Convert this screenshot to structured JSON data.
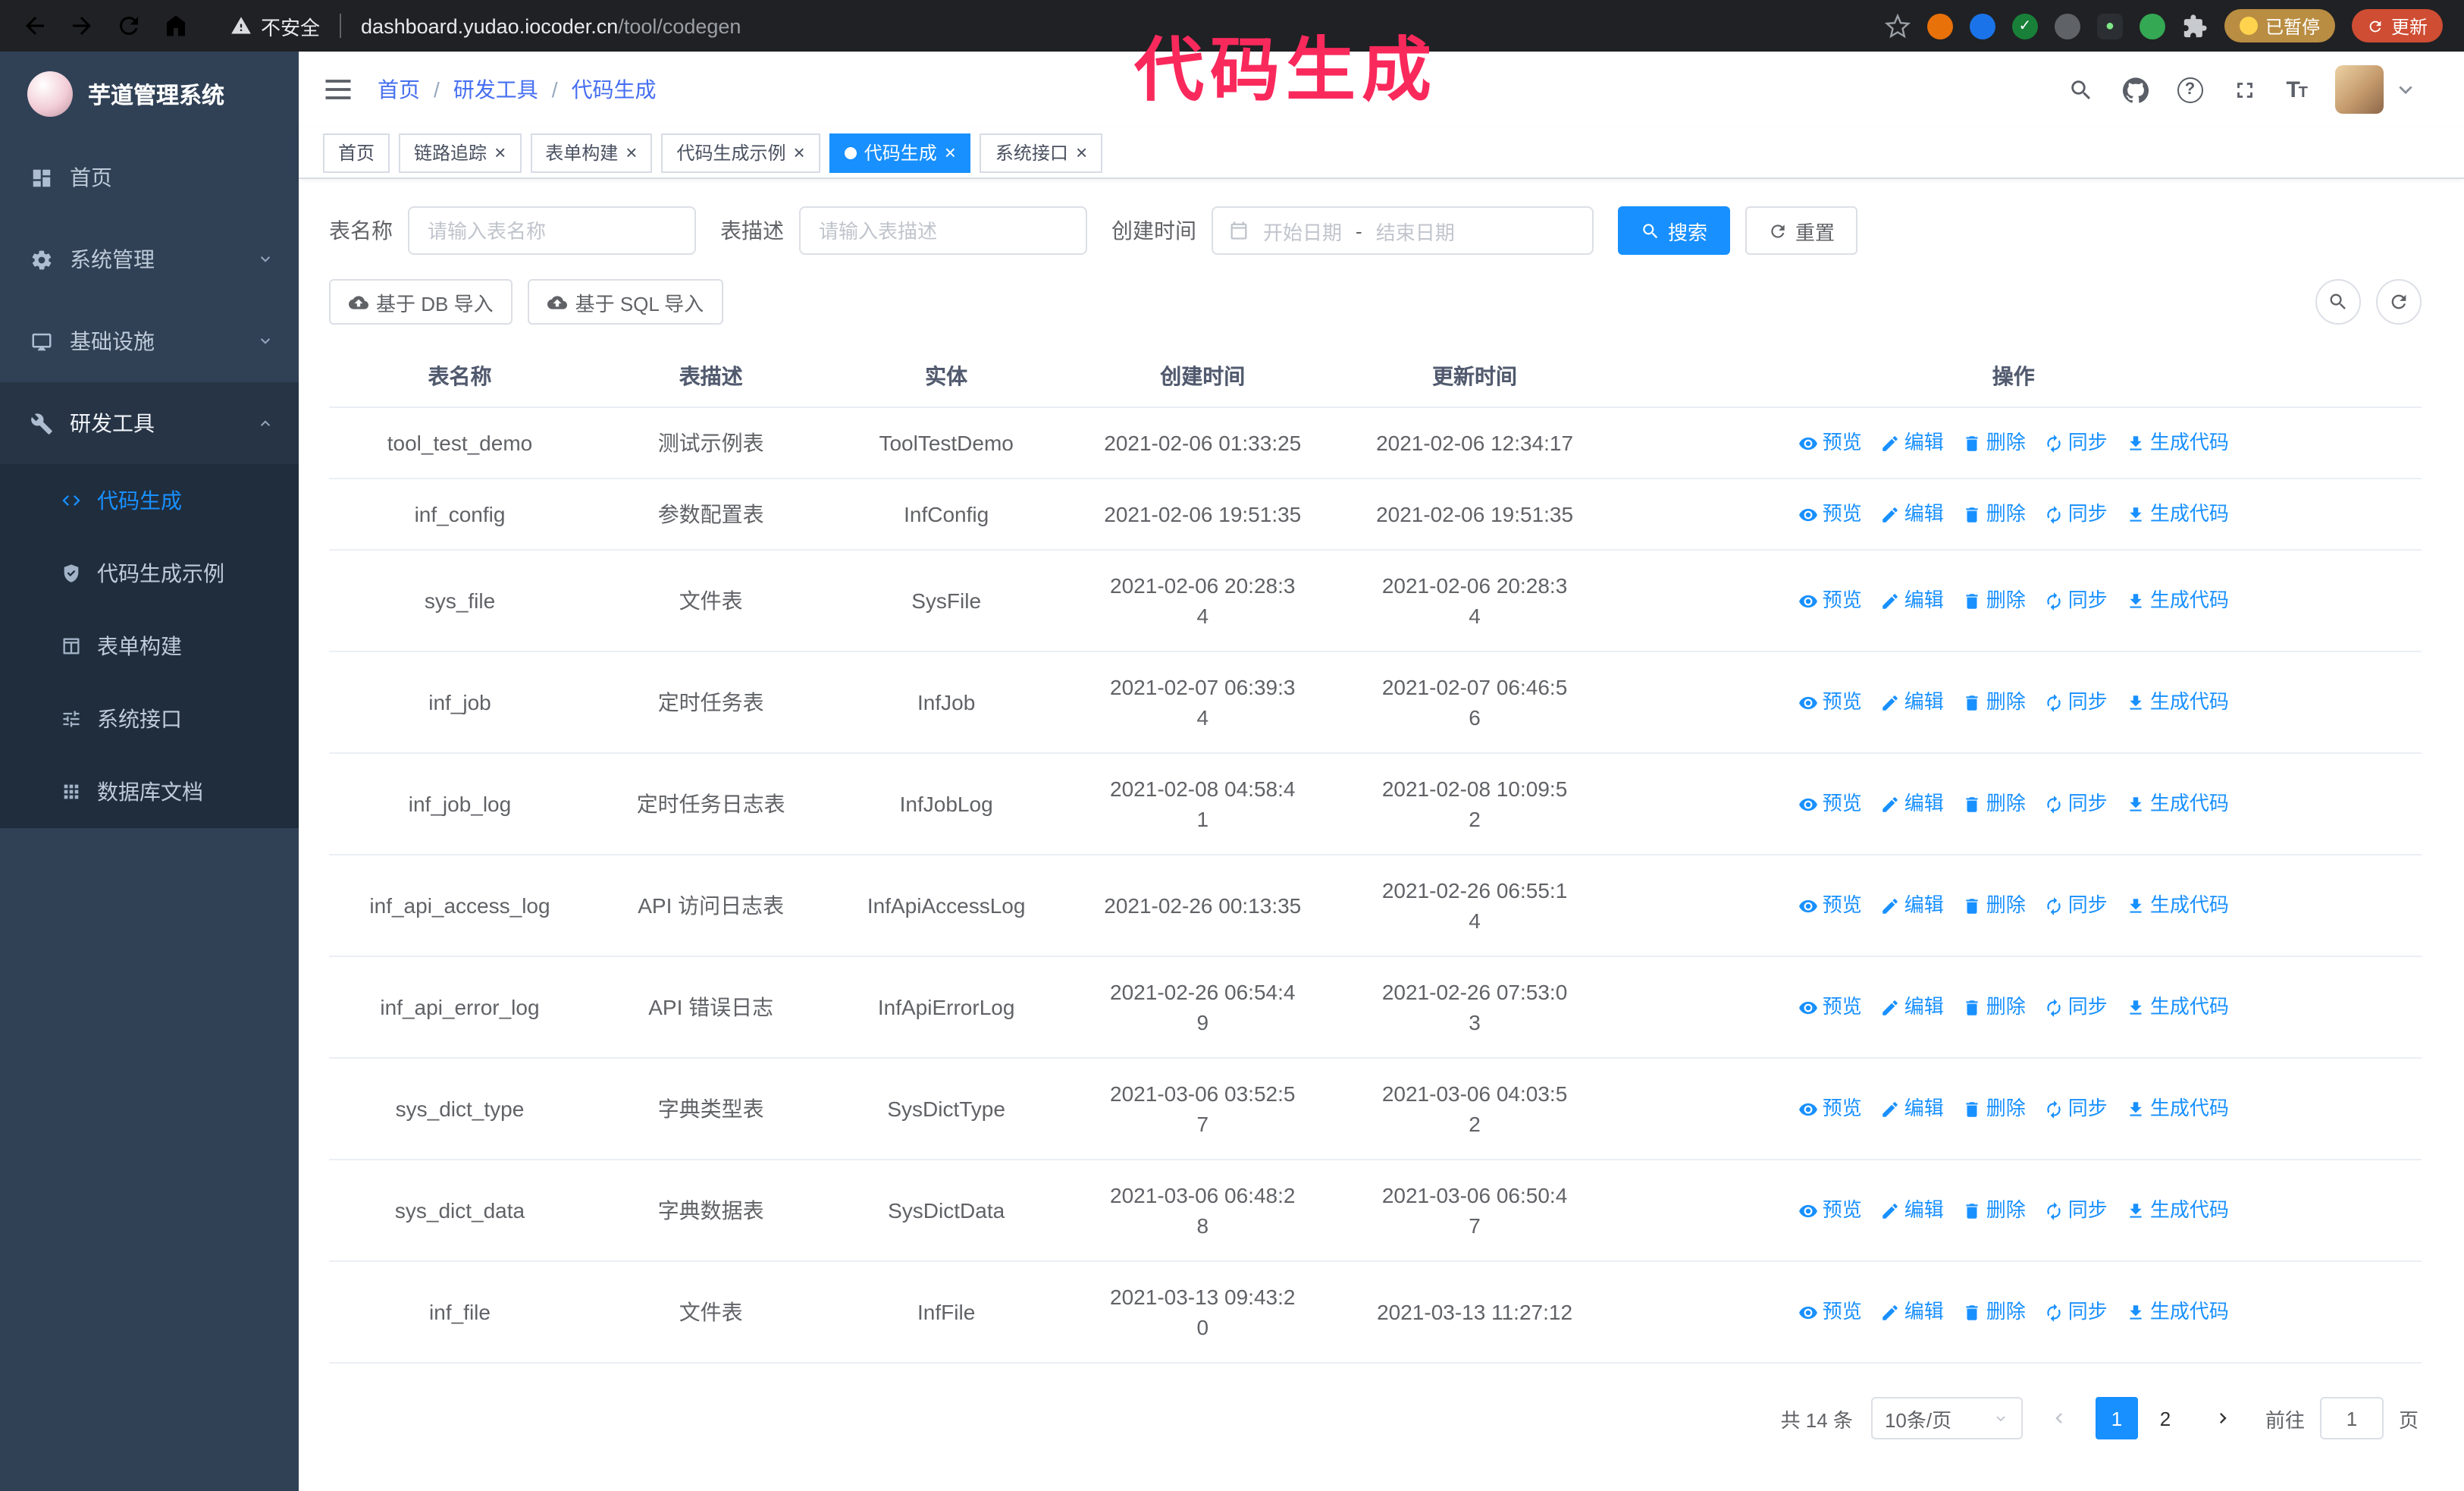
{
  "colors": {
    "accent": "#1890ff",
    "annotation": "#fa295c",
    "sidebar_bg": "#304156",
    "submenu_bg": "#1f2d3d"
  },
  "annotation": "代码生成",
  "browser": {
    "security_warning": "不安全",
    "url_host": "dashboard.yudao.iocoder.cn",
    "url_path": "/tool/codegen",
    "paused_badge": "已暂停",
    "update_button": "更新"
  },
  "sidebar": {
    "app_title": "芋道管理系统",
    "menu": [
      {
        "label": "首页",
        "icon": "dashboard",
        "type": "item"
      },
      {
        "label": "系统管理",
        "icon": "gear",
        "type": "group",
        "state": "collapsed"
      },
      {
        "label": "基础设施",
        "icon": "monitor",
        "type": "group",
        "state": "collapsed"
      },
      {
        "label": "研发工具",
        "icon": "wrench",
        "type": "group",
        "state": "expanded",
        "active": true
      }
    ],
    "submenu": [
      {
        "label": "代码生成",
        "icon": "code",
        "active": true
      },
      {
        "label": "代码生成示例",
        "icon": "shield"
      },
      {
        "label": "表单构建",
        "icon": "form"
      },
      {
        "label": "系统接口",
        "icon": "api"
      },
      {
        "label": "数据库文档",
        "icon": "grid"
      }
    ]
  },
  "navbar": {
    "breadcrumb": [
      "首页",
      "研发工具",
      "代码生成"
    ]
  },
  "tabs": [
    {
      "label": "首页",
      "closable": false,
      "active": false
    },
    {
      "label": "链路追踪",
      "closable": true,
      "active": false
    },
    {
      "label": "表单构建",
      "closable": true,
      "active": false
    },
    {
      "label": "代码生成示例",
      "closable": true,
      "active": false
    },
    {
      "label": "代码生成",
      "closable": true,
      "active": true
    },
    {
      "label": "系统接口",
      "closable": true,
      "active": false
    }
  ],
  "filters": {
    "table_name_label": "表名称",
    "table_name_placeholder": "请输入表名称",
    "table_desc_label": "表描述",
    "table_desc_placeholder": "请输入表描述",
    "create_time_label": "创建时间",
    "date_start_placeholder": "开始日期",
    "date_separator": "-",
    "date_end_placeholder": "结束日期",
    "search_button": "搜索",
    "reset_button": "重置"
  },
  "toolbar": {
    "import_db_button": "基于 DB 导入",
    "import_sql_button": "基于 SQL 导入"
  },
  "table": {
    "columns": [
      "表名称",
      "表描述",
      "实体",
      "创建时间",
      "更新时间",
      "操作"
    ],
    "op_labels": [
      "预览",
      "编辑",
      "删除",
      "同步",
      "生成代码"
    ],
    "rows": [
      {
        "name": "tool_test_demo",
        "desc": "测试示例表",
        "entity": "ToolTestDemo",
        "created": "2021-02-06 01:33:25",
        "updated": "2021-02-06 12:34:17"
      },
      {
        "name": "inf_config",
        "desc": "参数配置表",
        "entity": "InfConfig",
        "created": "2021-02-06 19:51:35",
        "updated": "2021-02-06 19:51:35"
      },
      {
        "name": "sys_file",
        "desc": "文件表",
        "entity": "SysFile",
        "created": "2021-02-06 20:28:3\n4",
        "updated": "2021-02-06 20:28:3\n4"
      },
      {
        "name": "inf_job",
        "desc": "定时任务表",
        "entity": "InfJob",
        "created": "2021-02-07 06:39:3\n4",
        "updated": "2021-02-07 06:46:5\n6"
      },
      {
        "name": "inf_job_log",
        "desc": "定时任务日志表",
        "entity": "InfJobLog",
        "created": "2021-02-08 04:58:4\n1",
        "updated": "2021-02-08 10:09:5\n2"
      },
      {
        "name": "inf_api_access_log",
        "desc": "API 访问日志表",
        "entity": "InfApiAccessLog",
        "created": "2021-02-26 00:13:35",
        "updated": "2021-02-26 06:55:1\n4"
      },
      {
        "name": "inf_api_error_log",
        "desc": "API 错误日志",
        "entity": "InfApiErrorLog",
        "created": "2021-02-26 06:54:4\n9",
        "updated": "2021-02-26 07:53:0\n3"
      },
      {
        "name": "sys_dict_type",
        "desc": "字典类型表",
        "entity": "SysDictType",
        "created": "2021-03-06 03:52:5\n7",
        "updated": "2021-03-06 04:03:5\n2"
      },
      {
        "name": "sys_dict_data",
        "desc": "字典数据表",
        "entity": "SysDictData",
        "created": "2021-03-06 06:48:2\n8",
        "updated": "2021-03-06 06:50:4\n7"
      },
      {
        "name": "inf_file",
        "desc": "文件表",
        "entity": "InfFile",
        "created": "2021-03-13 09:43:2\n0",
        "updated": "2021-03-13 11:27:12"
      }
    ]
  },
  "pagination": {
    "total": "共 14 条",
    "page_size": "10条/页",
    "pages": [
      "1",
      "2"
    ],
    "active_page": "1",
    "goto_label": "前往",
    "goto_value": "1",
    "goto_suffix": "页"
  }
}
